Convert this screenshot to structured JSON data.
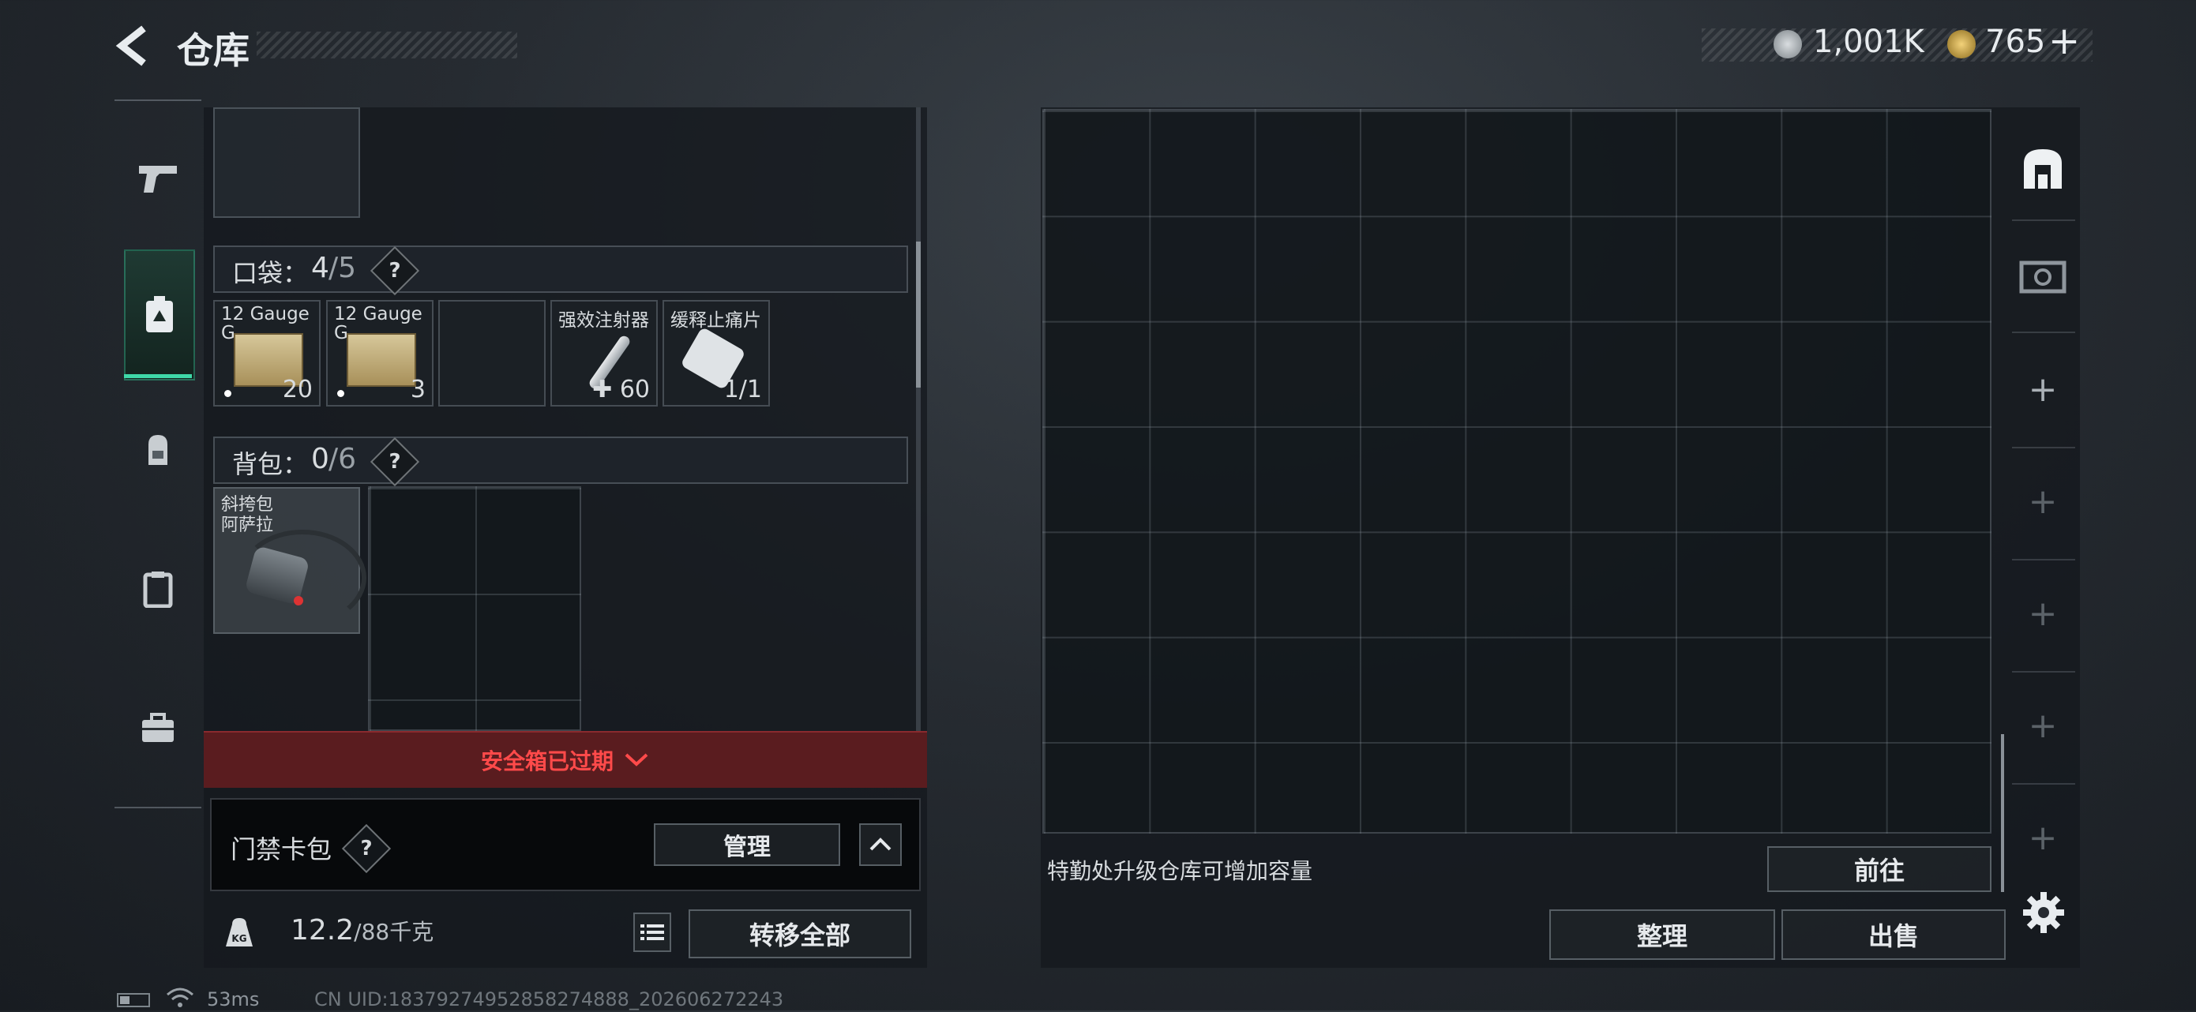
{
  "header": {
    "title": "仓库",
    "silver_value": "1,001K",
    "gold_value": "765",
    "plus_label": "+"
  },
  "left_tabs": [
    "pistol-icon",
    "secure-box-icon",
    "backpack-icon",
    "clipboard-icon",
    "toolbox-icon"
  ],
  "pockets": {
    "label": "口袋：",
    "count": "4",
    "capacity": "/5",
    "help": "?",
    "items": [
      {
        "name": "12 Gauge G",
        "count": "20"
      },
      {
        "name": "12 Gauge G",
        "count": "3"
      },
      {
        "name": "",
        "count": ""
      },
      {
        "name": "强效注射器",
        "count": "60",
        "prefix": "✚"
      },
      {
        "name": "缓释止痛片",
        "count": "1/1"
      }
    ]
  },
  "backpack": {
    "label": "背包：",
    "count": "0",
    "capacity": "/6",
    "help": "?",
    "item_name_line1": "斜挎包",
    "item_name_line2": "阿萨拉"
  },
  "secure_box": {
    "expired_label": "安全箱已过期"
  },
  "keycard": {
    "label": "门禁卡包",
    "help": "?",
    "manage_label": "管理"
  },
  "weight": {
    "current": "12.2",
    "max": "/88千克",
    "icon_label": "KG"
  },
  "transfer_all_label": "转移全部",
  "storage": {
    "upgrade_hint": "特勤处升级仓库可增加容量",
    "goto_label": "前往",
    "sort_label": "整理",
    "sell_label": "出售"
  },
  "right_tabs": [
    "storage-icon",
    "vault-icon",
    "+",
    "+",
    "+",
    "+",
    "+"
  ],
  "status": {
    "ping": "53ms",
    "uid": "CN UID:18379274952858274888_202606272243"
  },
  "colors": {
    "expired_bg": "#5a1c1f",
    "expired_text": "#ff4a4a",
    "accent": "#3fd8a8"
  }
}
